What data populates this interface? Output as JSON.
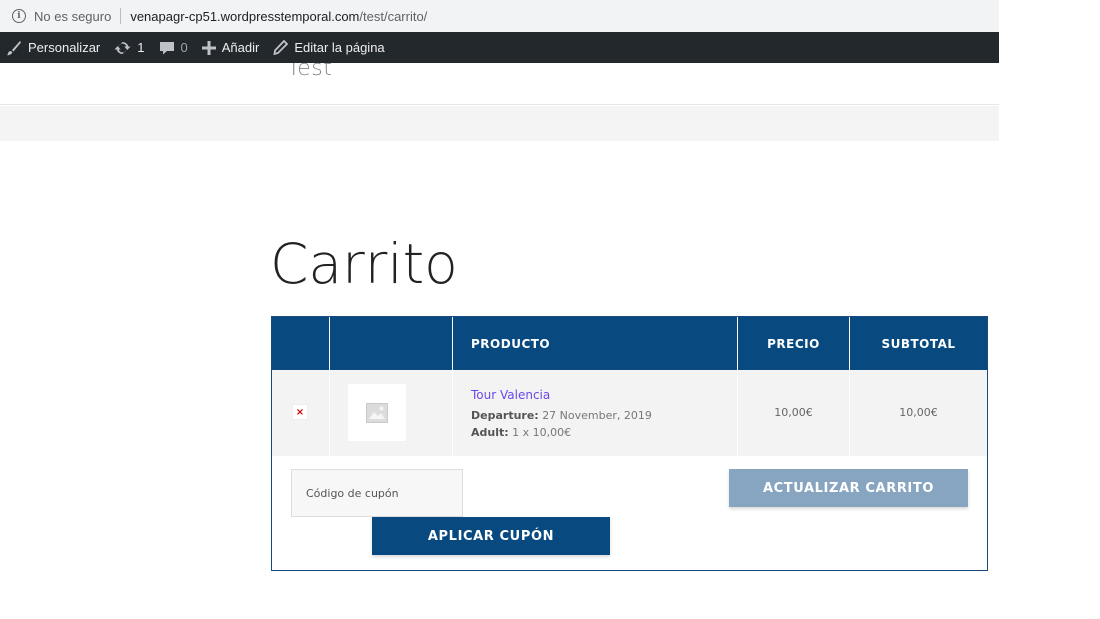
{
  "browser": {
    "security_label": "No es seguro",
    "url_host": "venapagr-cp51.wordpresstemporal.com",
    "url_path": "/test/carrito/"
  },
  "admin_bar": {
    "customize_label": "Personalizar",
    "updates_count": "1",
    "comments_count": "0",
    "add_new_label": "Añadir",
    "edit_page_label": "Editar la página"
  },
  "site": {
    "title": "Test"
  },
  "page": {
    "title": "Carrito"
  },
  "cart": {
    "headers": {
      "remove": "",
      "thumbnail": "",
      "product": "PRODUCTO",
      "price": "PRECIO",
      "subtotal": "SUBTOTAL"
    },
    "items": [
      {
        "remove_symbol": "×",
        "name": "Tour Valencia",
        "departure_label": "Departure:",
        "departure_value": "27 November, 2019",
        "adult_label": "Adult:",
        "adult_value": "1 x 10,00€",
        "price": "10,00€",
        "subtotal": "10,00€"
      }
    ],
    "coupon_placeholder": "Código de cupón",
    "apply_coupon_label": "APLICAR CUPÓN",
    "update_cart_label": "ACTUALIZAR CARRITO"
  },
  "colors": {
    "header_blue": "#084a80",
    "update_button": "#87a5c1",
    "admin_bar": "#23282d",
    "product_link": "#6b49e8"
  }
}
